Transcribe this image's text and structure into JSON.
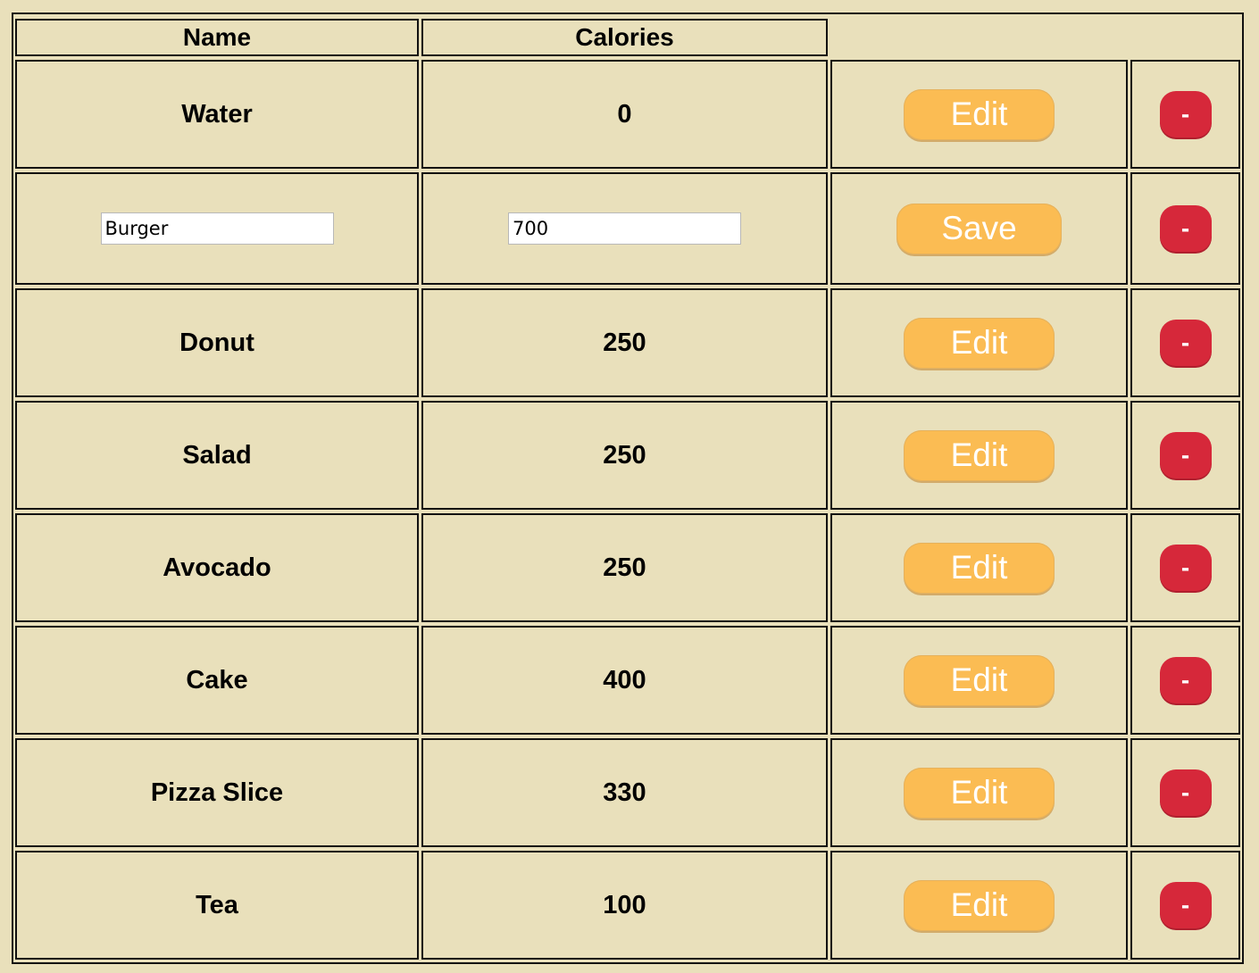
{
  "headers": {
    "name": "Name",
    "calories": "Calories"
  },
  "buttons": {
    "edit_label": "Edit",
    "save_label": "Save",
    "delete_label": "-"
  },
  "rows": [
    {
      "name": "Water",
      "calories": "0",
      "editing": false
    },
    {
      "name": "Burger",
      "calories": "700",
      "editing": true
    },
    {
      "name": "Donut",
      "calories": "250",
      "editing": false
    },
    {
      "name": "Salad",
      "calories": "250",
      "editing": false
    },
    {
      "name": "Avocado",
      "calories": "250",
      "editing": false
    },
    {
      "name": "Cake",
      "calories": "400",
      "editing": false
    },
    {
      "name": "Pizza Slice",
      "calories": "330",
      "editing": false
    },
    {
      "name": "Tea",
      "calories": "100",
      "editing": false
    }
  ],
  "colors": {
    "background": "#e9e0bb",
    "edit_button": "#fbbc53",
    "delete_button": "#d6283a"
  }
}
